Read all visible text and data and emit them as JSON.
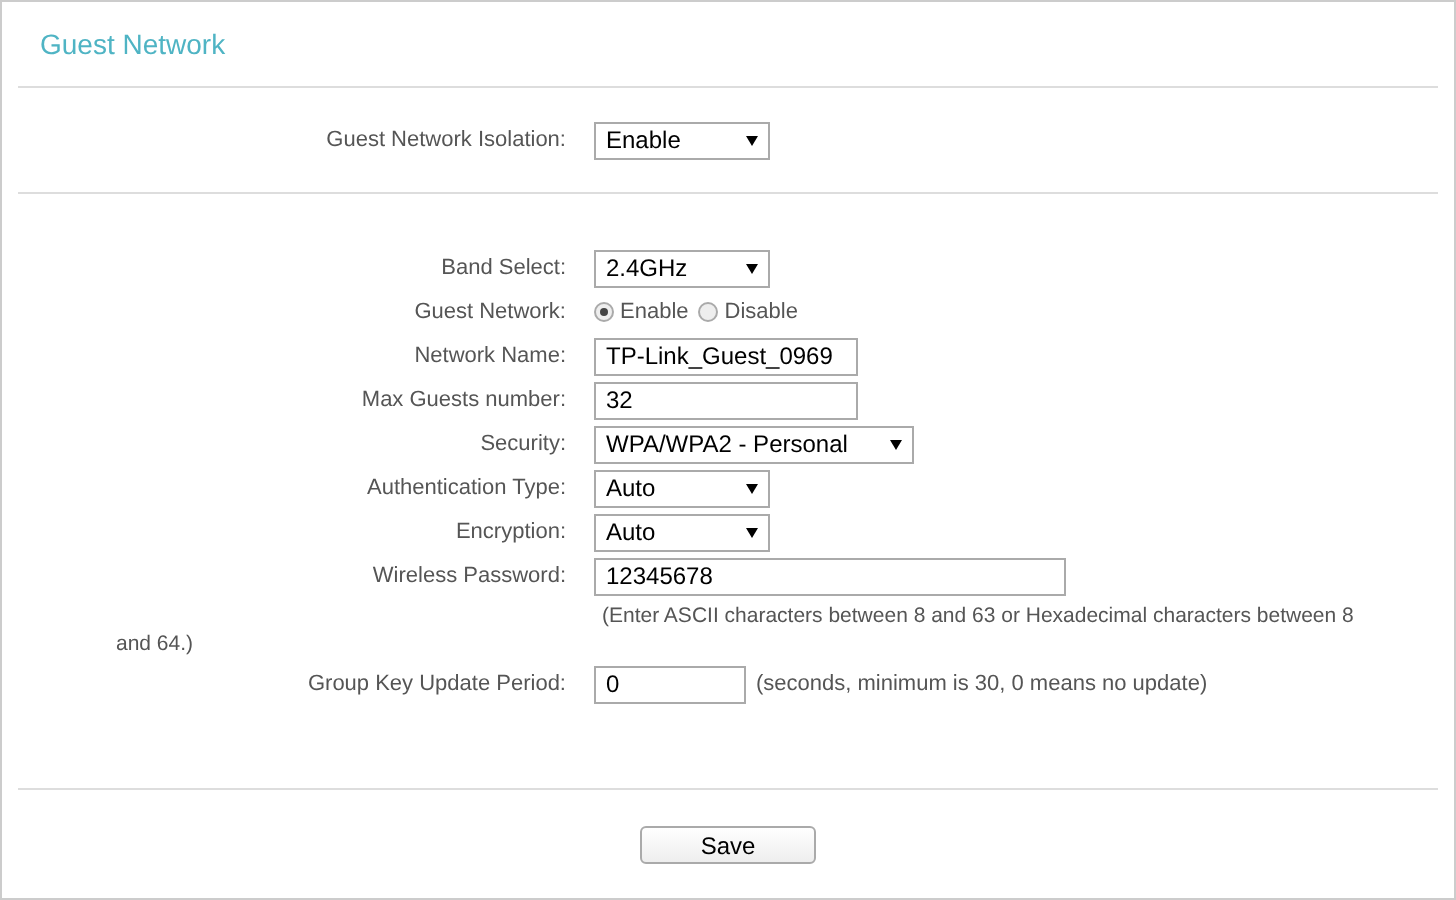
{
  "title": "Guest Network",
  "isolation": {
    "label": "Guest Network Isolation:",
    "value": "Enable"
  },
  "fields": [
    {
      "kind": "select",
      "label": "Band Select:",
      "value": "2.4GHz"
    },
    {
      "kind": "radio",
      "label": "Guest Network:",
      "options": [
        {
          "label": "Enable",
          "selected": true
        },
        {
          "label": "Disable",
          "selected": false
        }
      ]
    },
    {
      "kind": "text",
      "label": "Network Name:",
      "value": "TP-Link_Guest_0969"
    },
    {
      "kind": "text",
      "label": "Max Guests number:",
      "value": "32"
    },
    {
      "kind": "select",
      "label": "Security:",
      "value": "WPA/WPA2 - Personal"
    },
    {
      "kind": "select",
      "label": "Authentication Type:",
      "value": "Auto"
    },
    {
      "kind": "select",
      "label": "Encryption:",
      "value": "Auto"
    },
    {
      "kind": "text",
      "label": "Wireless Password:",
      "value": "12345678"
    },
    {
      "kind": "hint",
      "text": "(Enter ASCII characters between 8 and 63 or Hexadecimal characters between 8 and 64.)"
    },
    {
      "kind": "text",
      "label": "Group Key Update Period:",
      "value": "0",
      "suffix": "(seconds, minimum is 30, 0 means no update)"
    }
  ],
  "save_button": "Save"
}
